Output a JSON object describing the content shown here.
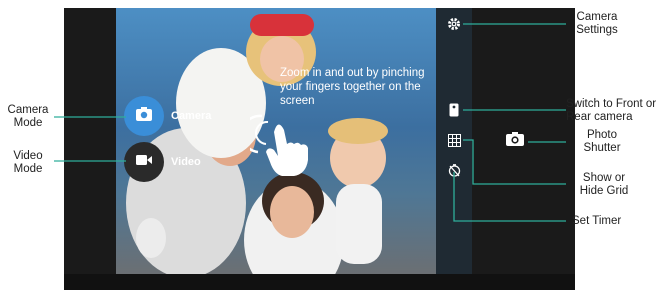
{
  "hint_text": "Zoom in and out by pinching your fingers together on the screen",
  "modes": {
    "camera_label": "Camera",
    "video_label": "Video"
  },
  "callouts": {
    "camera_mode": "Camera Mode",
    "video_mode": "Video Mode",
    "camera_settings": "Camera Settings",
    "switch_camera": "Switch to Front or Rear camera",
    "photo_shutter": "Photo Shutter",
    "grid": "Show or Hide Grid",
    "timer": "Set Timer"
  },
  "colors": {
    "accent_line": "#2fae9a",
    "camera_mode_active": "#3a8ed8",
    "video_mode_idle": "#2a2a2a"
  },
  "icons": [
    "settings-gear-icon",
    "switch-camera-icon",
    "grid-icon",
    "timer-icon",
    "shutter-camera-icon",
    "camera-icon",
    "video-icon",
    "pinch-hand-icon"
  ]
}
